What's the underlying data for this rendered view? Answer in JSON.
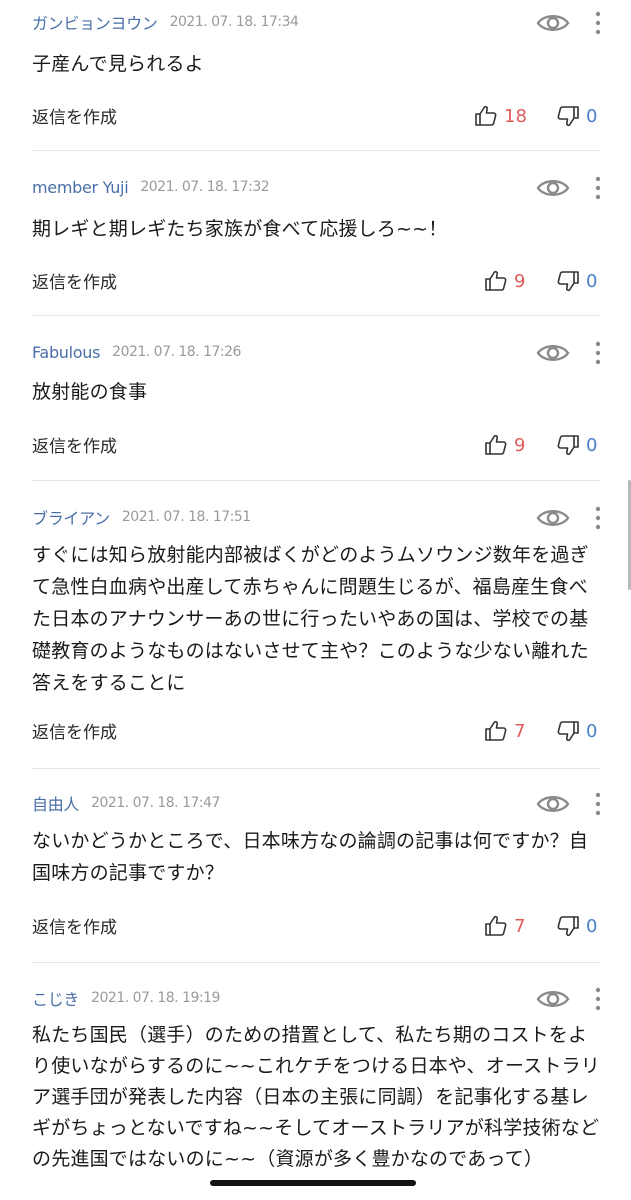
{
  "reply_label": "返信を作成",
  "colors": {
    "author": "#4a6fa8",
    "date": "#9a9a9a",
    "like_count": "#e05a5a",
    "dislike_count": "#4a80c8"
  },
  "comments": [
    {
      "author": "ガンビョンヨウン",
      "date": "2021. 07. 18. 17:34",
      "text": "子産んで見られるよ",
      "likes": "18",
      "dislikes": "0"
    },
    {
      "author": "member Yuji",
      "date": "2021. 07. 18. 17:32",
      "text": "期レギと期レギたち家族が食べて応援しろ~~！",
      "likes": "9",
      "dislikes": "0"
    },
    {
      "author": "Fabulous",
      "date": "2021. 07. 18. 17:26",
      "text": "放射能の食事",
      "likes": "9",
      "dislikes": "0"
    },
    {
      "author": "ブライアン",
      "date": "2021. 07. 18. 17:51",
      "text": "すぐには知ら放射能内部被ばくがどのようムソウンジ数年を過ぎて急性白血病や出産して赤ちゃんに問題生じるが、福島産生食べた日本のアナウンサーあの世に行ったいやあの国は、学校での基礎教育のようなものはないさせて主や？このような少ない離れた答えをすることに",
      "likes": "7",
      "dislikes": "0"
    },
    {
      "author": "自由人",
      "date": "2021. 07. 18. 17:47",
      "text": "ないかどうかところで、日本味方なの論調の記事は何ですか？自国味方の記事ですか？",
      "likes": "7",
      "dislikes": "0"
    },
    {
      "author": "こじき",
      "date": "2021. 07. 18. 19:19",
      "text": "私たち国民（選手）のための措置として、私たち期のコストをより使いながらするのに~~これケチをつける日本や、オーストラリア選手団が発表した内容（日本の主張に同調）を記事化する基レギがちょっとないですね~~そしてオーストラリアが科学技術などの先進国ではないのに~~（資源が多く豊かなのであって）"
    }
  ]
}
